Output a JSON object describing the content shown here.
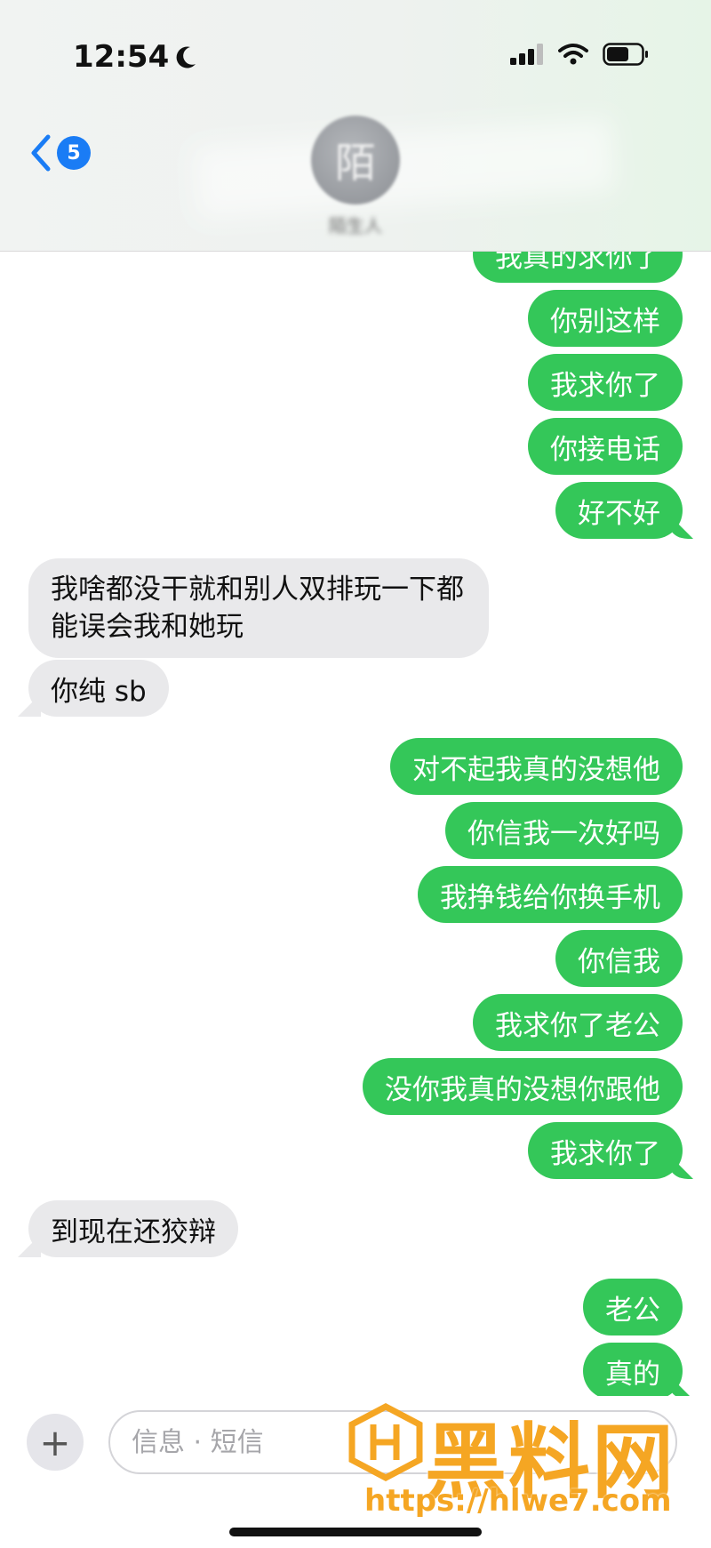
{
  "status_bar": {
    "time": "12:54"
  },
  "header": {
    "back_badge": "5",
    "avatar_initial": "陌",
    "contact_name": "陌生人"
  },
  "messages": [
    {
      "dir": "sent",
      "text": "我真的求你了"
    },
    {
      "dir": "sent",
      "text": "你别这样"
    },
    {
      "dir": "sent",
      "text": "我求你了"
    },
    {
      "dir": "sent",
      "text": "你接电话"
    },
    {
      "dir": "sent",
      "text": "好不好"
    },
    {
      "dir": "received",
      "text": "我啥都没干就和别人双排玩一下都能误会我和她玩"
    },
    {
      "dir": "received",
      "text": "你纯 sb"
    },
    {
      "dir": "sent",
      "text": "对不起我真的没想他"
    },
    {
      "dir": "sent",
      "text": "你信我一次好吗"
    },
    {
      "dir": "sent",
      "text": "我挣钱给你换手机"
    },
    {
      "dir": "sent",
      "text": "你信我"
    },
    {
      "dir": "sent",
      "text": "我求你了老公"
    },
    {
      "dir": "sent",
      "text": "没你我真的没想你跟他"
    },
    {
      "dir": "sent",
      "text": "我求你了"
    },
    {
      "dir": "received",
      "text": "到现在还狡辩"
    },
    {
      "dir": "sent",
      "text": "老公"
    },
    {
      "dir": "sent",
      "text": "真的"
    }
  ],
  "composer": {
    "plus_label": "+",
    "placeholder": "信息 · 短信"
  },
  "watermark": {
    "title": "黑料网",
    "url": "https://hlwe7.com"
  },
  "colors": {
    "sent_bubble": "#34c759",
    "received_bubble": "#e9e9eb",
    "badge": "#1a7cf5",
    "watermark": "#f5a623"
  }
}
